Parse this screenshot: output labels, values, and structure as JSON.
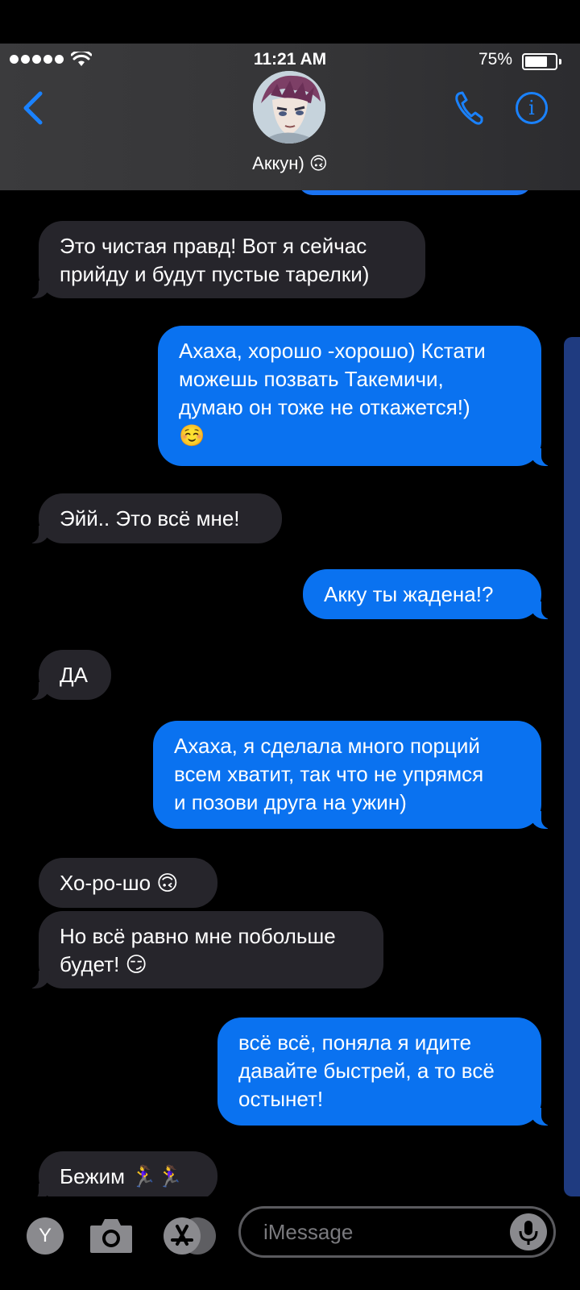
{
  "status_bar": {
    "time": "11:21 AM",
    "battery_percent": "75%"
  },
  "header": {
    "contact_name": "Аккун) 🙃"
  },
  "messages": [
    {
      "side": "in",
      "lines": [
        "Это чистая правд! Вот я сейчас",
        "прийду и будут пустые тарелки)"
      ]
    },
    {
      "side": "out",
      "lines": [
        "Ахаха, хорошо -хорошо) Кстати",
        "можешь позвать Такемичи,",
        "думаю он тоже не откажется!)",
        "☺️"
      ]
    },
    {
      "side": "in",
      "lines": [
        "Эйй.. Это всё мне!"
      ]
    },
    {
      "side": "out",
      "lines": [
        "Акку ты жадена!?"
      ]
    },
    {
      "side": "in",
      "lines": [
        "ДА"
      ]
    },
    {
      "side": "out",
      "lines": [
        "Ахаха, я сделала много порций",
        "всем хватит, так что не упрямся",
        "и позови друга на ужин)"
      ]
    },
    {
      "side": "in",
      "lines": [
        "Хо-ро-шо 🙃"
      ]
    },
    {
      "side": "in",
      "lines": [
        "Но всё равно мне побольше",
        "будет! 😏"
      ]
    },
    {
      "side": "out",
      "lines": [
        "всё всё, поняла я  идите",
        "давайте быстрей, а то всё",
        "остынет!"
      ]
    },
    {
      "side": "in",
      "lines": [
        "Бежим 🏃‍♀️🏃‍♀️"
      ]
    }
  ],
  "composer": {
    "app_button_label": "Y",
    "placeholder": "iMessage"
  },
  "colors": {
    "accent": "#1a82ff",
    "outgoing_bubble": "#0a72f0",
    "incoming_bubble": "#26252b"
  }
}
